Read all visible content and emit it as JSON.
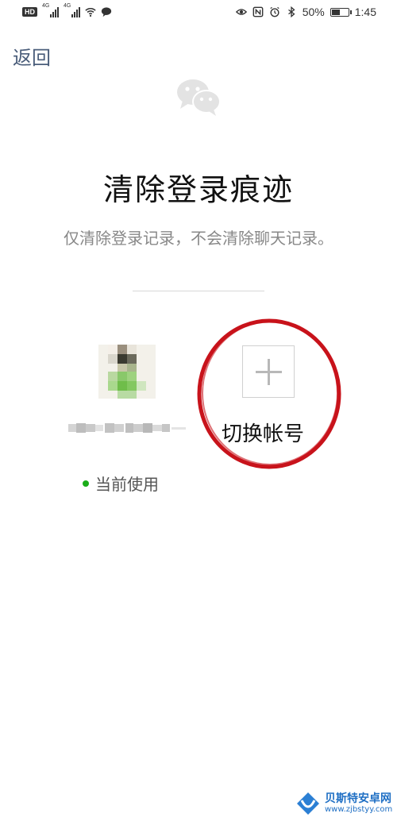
{
  "status_bar": {
    "hd_badge": "HD",
    "network_1": "4G",
    "network_2": "4G",
    "battery_percent": "50%",
    "time": "1:45",
    "battery_level": 0.5
  },
  "nav": {
    "back_label": "返回"
  },
  "header": {
    "title": "清除登录痕迹",
    "subtitle": "仅清除登录记录，不会清除聊天记录。"
  },
  "current_account": {
    "status_text": "当前使用",
    "status_color": "#1aad19"
  },
  "switch_account": {
    "label": "切换帐号",
    "highlight_color": "#c8131b"
  },
  "watermark": {
    "name": "贝斯特安卓网",
    "url": "www.zjbstyy.com"
  },
  "icons": [
    "wechat-logo-icon",
    "plus-icon",
    "wifi-icon",
    "chat-bubble-icon",
    "eye-icon",
    "nfc-icon",
    "alarm-icon",
    "bluetooth-icon",
    "battery-icon"
  ]
}
